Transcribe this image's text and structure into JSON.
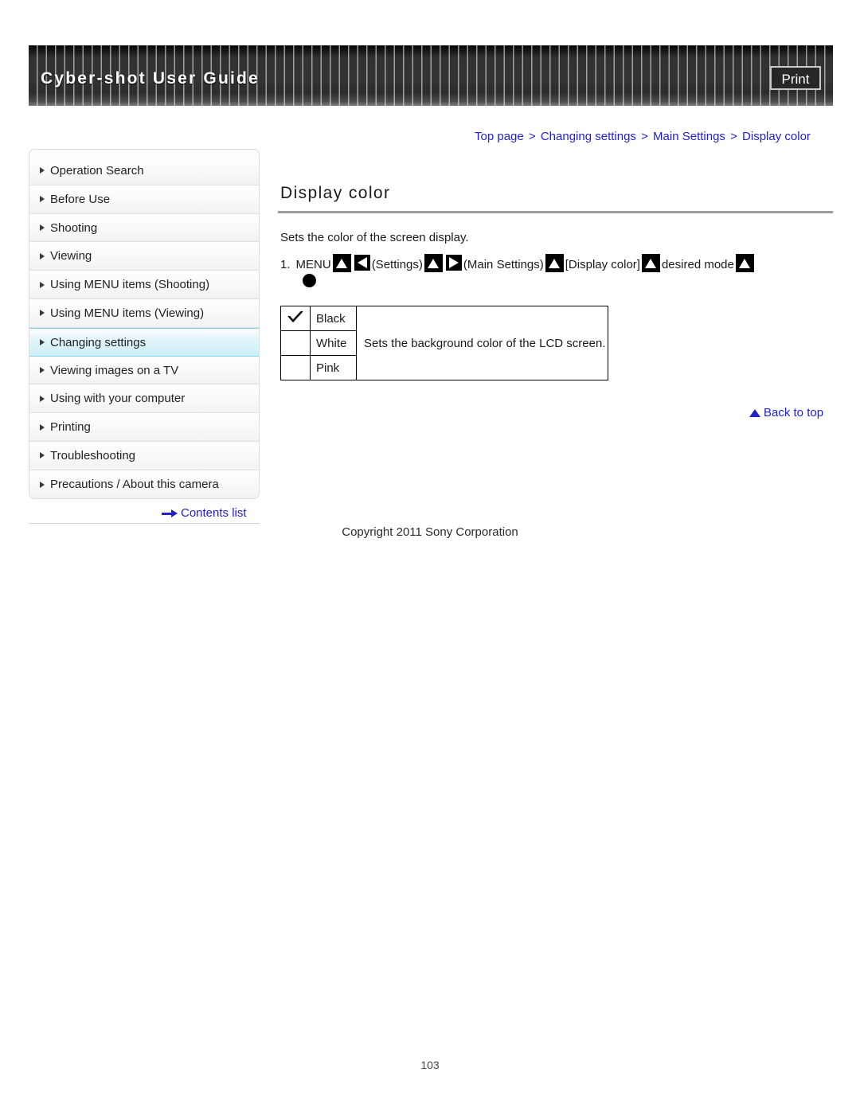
{
  "header": {
    "title": "Cyber-shot User Guide",
    "print_label": "Print"
  },
  "breadcrumb": {
    "separator": ">",
    "items": [
      {
        "label": "Top page"
      },
      {
        "label": "Changing settings"
      },
      {
        "label": "Main Settings"
      },
      {
        "label": "Display color"
      }
    ]
  },
  "sidebar": {
    "items": [
      {
        "label": "Operation Search",
        "active": false
      },
      {
        "label": "Before Use",
        "active": false
      },
      {
        "label": "Shooting",
        "active": false
      },
      {
        "label": "Viewing",
        "active": false
      },
      {
        "label": "Using MENU items (Shooting)",
        "active": false
      },
      {
        "label": "Using MENU items (Viewing)",
        "active": false
      },
      {
        "label": "Changing settings",
        "active": true
      },
      {
        "label": "Viewing images on a TV",
        "active": false
      },
      {
        "label": "Using with your computer",
        "active": false
      },
      {
        "label": "Printing",
        "active": false
      },
      {
        "label": "Troubleshooting",
        "active": false
      },
      {
        "label": "Precautions / About this camera",
        "active": false
      }
    ],
    "contents_list_label": "Contents list"
  },
  "main": {
    "title": "Display color",
    "intro": "Sets the color of the screen display.",
    "step": {
      "number": "1.",
      "menu_label": "MENU",
      "settings_label": "(Settings)",
      "main_settings_label": "(Main Settings)",
      "display_color_label": "[Display color]",
      "desired_mode_label": "desired mode"
    },
    "table": {
      "rows": [
        {
          "checked": true,
          "name": "Black"
        },
        {
          "checked": false,
          "name": "White"
        },
        {
          "checked": false,
          "name": "Pink"
        }
      ],
      "description": "Sets the background color of the LCD screen."
    },
    "back_to_top_label": "Back to top"
  },
  "footer": {
    "copyright": "Copyright 2011 Sony Corporation",
    "page_number": "103"
  },
  "colors": {
    "link": "#2222cc",
    "header_bg": "#313131",
    "active_nav": "#cceef6",
    "rule": "#9a9a9a"
  }
}
